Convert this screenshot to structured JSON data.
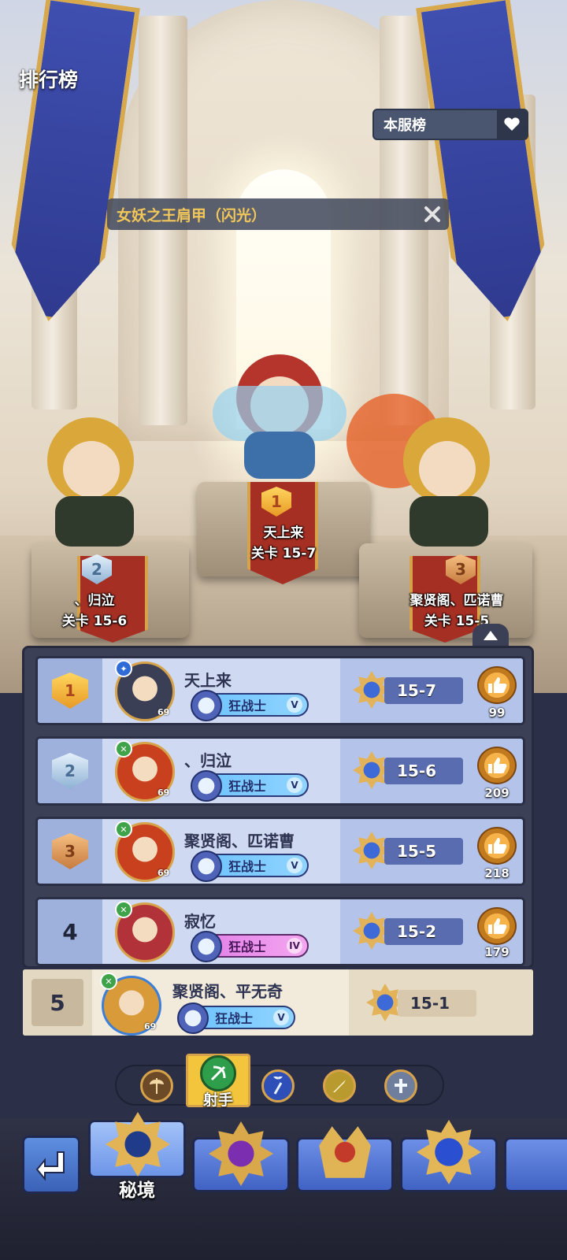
{
  "header": {
    "title": "排行榜"
  },
  "server_select": {
    "selected": "本服榜"
  },
  "item_tip": {
    "text": "女妖之王肩甲（闪光）"
  },
  "podium": [
    {
      "rank": "1",
      "name": "天上来",
      "stage": "关卡 15-7"
    },
    {
      "rank": "2",
      "name": "、归泣",
      "stage": "关卡 15-6"
    },
    {
      "rank": "3",
      "name": "聚贤阁、匹诺曹",
      "stage": "关卡 15-5"
    }
  ],
  "ranking": [
    {
      "rank": "1",
      "name": "天上来",
      "level": "69",
      "class": "狂战士",
      "grade": "V",
      "stage": "15-7",
      "likes": "99"
    },
    {
      "rank": "2",
      "name": "、归泣",
      "level": "69",
      "class": "狂战士",
      "grade": "V",
      "stage": "15-6",
      "likes": "209"
    },
    {
      "rank": "3",
      "name": "聚贤阁、匹诺曹",
      "level": "69",
      "class": "狂战士",
      "grade": "V",
      "stage": "15-5",
      "likes": "218"
    },
    {
      "rank": "4",
      "name": "寂忆",
      "level": "",
      "class": "狂战士",
      "grade": "IV",
      "stage": "15-2",
      "likes": "179"
    }
  ],
  "self_row": {
    "rank": "5",
    "name": "聚贤阁、平无奇",
    "level": "69",
    "class": "狂战士",
    "grade": "V",
    "stage": "15-1"
  },
  "filters": {
    "active_label": "射手",
    "items": [
      "axe-icon",
      "bow-icon",
      "staff-icon",
      "blade-icon",
      "holy-icon"
    ]
  },
  "bottom_nav": {
    "active_label": "秘境"
  },
  "colors": {
    "accent_gold": "#d6a24a",
    "row_bg": "#cfd9f2",
    "self_bg": "#f2ebdc",
    "banner_blue": "#3f4fb0"
  }
}
